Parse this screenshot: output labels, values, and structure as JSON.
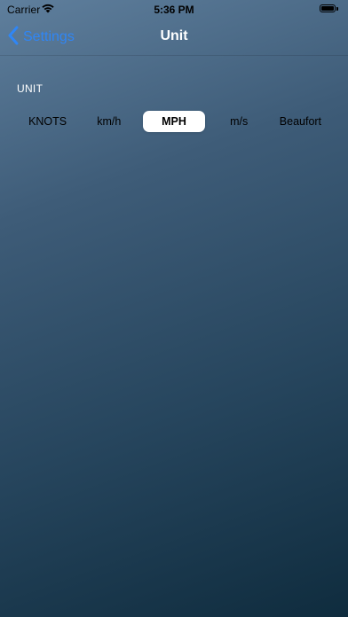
{
  "status_bar": {
    "carrier": "Carrier",
    "time": "5:36 PM",
    "wifi_icon": "wifi-icon",
    "battery_icon": "battery-icon"
  },
  "nav": {
    "back_label": "Settings",
    "title": "Unit",
    "accent_color": "#2f86f6"
  },
  "unit_section": {
    "header": "UNIT",
    "segments": [
      {
        "label": "KNOTS",
        "selected": false
      },
      {
        "label": "km/h",
        "selected": false
      },
      {
        "label": "MPH",
        "selected": true
      },
      {
        "label": "m/s",
        "selected": false
      },
      {
        "label": "Beaufort",
        "selected": false
      }
    ]
  }
}
